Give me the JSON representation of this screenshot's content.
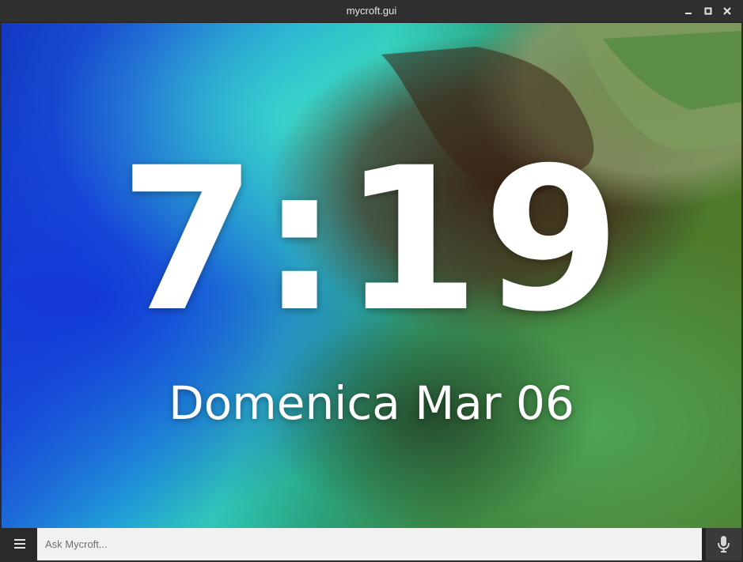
{
  "window": {
    "title": "mycroft.gui"
  },
  "clock": {
    "time": "7:19",
    "date": "Domenica Mar 06"
  },
  "input": {
    "placeholder": "Ask Mycroft...",
    "value": ""
  },
  "icons": {
    "minimize": "minimize-icon",
    "maximize": "maximize-icon",
    "close": "close-icon",
    "menu": "hamburger-menu-icon",
    "mic": "microphone-icon"
  },
  "colors": {
    "titlebar": "#2f2f2f",
    "input_bg": "#f1f1f1",
    "text": "#ffffff"
  }
}
